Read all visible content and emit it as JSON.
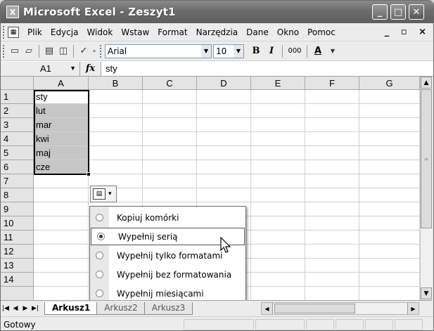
{
  "window": {
    "title": "Microsoft Excel - Zeszyt1",
    "app_icon": "X"
  },
  "title_controls": {
    "minimize": "_",
    "maximize": "□",
    "close": "✕"
  },
  "menubar": {
    "items": [
      "Plik",
      "Edycja",
      "Widok",
      "Wstaw",
      "Format",
      "Narzędzia",
      "Dane",
      "Okno",
      "Pomoc"
    ],
    "right": "_ ▫ ×"
  },
  "toolbar": {
    "font": "Arial",
    "size": "10",
    "bold": "B",
    "italic": "I",
    "thousands": "000",
    "font_color": "A",
    "icons": [
      "new-icon",
      "open-icon",
      "print-icon",
      "print-preview-icon",
      "spelling-icon"
    ]
  },
  "formula_bar": {
    "name_box": "A1",
    "fx": "fx",
    "value": "sty"
  },
  "grid": {
    "columns": [
      "A",
      "B",
      "C",
      "D",
      "E",
      "F",
      "G"
    ],
    "rows": [
      "1",
      "2",
      "3",
      "4",
      "5",
      "6",
      "7",
      "8",
      "9",
      "10",
      "11",
      "12",
      "13",
      "14"
    ],
    "col_a_values": [
      "sty",
      "lut",
      "mar",
      "kwi",
      "maj",
      "cze"
    ]
  },
  "paste_options": {
    "icon": "▤",
    "arrow": "▾"
  },
  "autofill_menu": {
    "options": [
      "Kopiuj komórki",
      "Wypełnij serią",
      "Wypełnij tylko formatami",
      "Wypełnij bez formatowania",
      "Wypełnij miesiącami"
    ],
    "selected_index": 1
  },
  "sheet_tabs": [
    "Arkusz1",
    "Arkusz2",
    "Arkusz3"
  ],
  "status": "Gotowy",
  "colors": {
    "titlebar": "#6c6c6c",
    "selection": "#c6c6c6",
    "window_bg": "#ececec"
  }
}
